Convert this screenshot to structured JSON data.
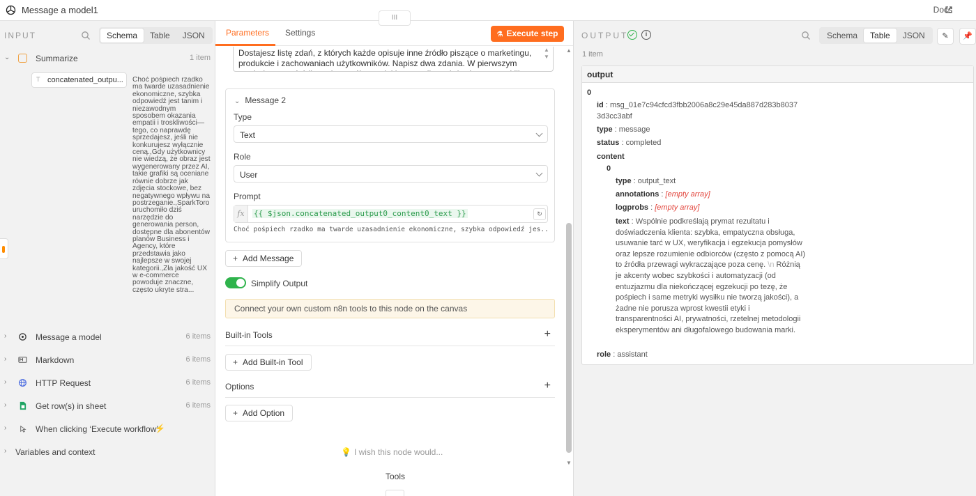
{
  "window": {
    "title": "Message a model1",
    "docs_label": "Docs",
    "drag_handle": "III"
  },
  "input": {
    "heading": "INPUT",
    "views": [
      "Schema",
      "Table",
      "JSON"
    ],
    "active_view": "Schema",
    "summarize": {
      "label": "Summarize",
      "count": "1 item"
    },
    "field": {
      "type_glyph": "T",
      "name": "concatenated_outpu...",
      "value": "Choć pośpiech rzadko ma twarde uzasadnienie ekonomiczne, szybka odpowiedź jest tanim i niezawodnym sposobem okazania empatii i troskliwości—tego, co naprawdę sprzedajesz, jeśli nie konkurujesz wyłącznie ceną.,Gdy użytkownicy nie wiedzą, że obraz jest wygenerowany przez AI, takie grafiki są oceniane równie dobrze jak zdjęcia stockowe, bez negatywnego wpływu na postrzeganie.,SparkToro uruchomiło dziś narzędzie do generowania person, dostępne dla abonentów planów Business i Agency, które przedstawia jako najlepsze w swojej kategorii.,Zła jakość UX w e-commerce powoduje znaczne, często ukryte stra..."
    },
    "nodes": [
      {
        "label": "Message a model",
        "count": "6 items",
        "icon": "openai-icon"
      },
      {
        "label": "Markdown",
        "count": "6 items",
        "icon": "markdown-icon"
      },
      {
        "label": "HTTP Request",
        "count": "6 items",
        "icon": "globe-icon"
      },
      {
        "label": "Get row(s) in sheet",
        "count": "6 items",
        "icon": "sheets-icon"
      },
      {
        "label": "When clicking ‘Execute workflow’",
        "count": "",
        "icon": "cursor-icon"
      }
    ],
    "variables_label": "Variables and context"
  },
  "params": {
    "tabs": [
      "Parameters",
      "Settings"
    ],
    "active_tab": "Parameters",
    "execute_label": "Execute step",
    "message1_text": "Dostajesz listę zdań, z których każde opisuje inne źródło piszące o marketingu, produkcie i zachowaniach użytkowników. Napisz dwa zdania. W pierwszym powiedz, co te źródła mają wspólnego, jaki temat albo założenie wraca u kilku",
    "message2": {
      "heading": "Message 2",
      "type_label": "Type",
      "type_value": "Text",
      "role_label": "Role",
      "role_value": "User",
      "prompt_label": "Prompt",
      "fx": "fx",
      "expression": "{{ $json.concatenated_output0_content0_text }}",
      "preview": "Choć pośpiech rzadko ma twarde uzasadnienie ekonomiczne, szybka odpowiedź jes..."
    },
    "add_message_label": "Add Message",
    "simplify_label": "Simplify Output",
    "simplify_on": true,
    "notice": "Connect your own custom n8n tools to this node on the canvas",
    "builtin_tools_label": "Built-in Tools",
    "add_builtin_label": "Add Built-in Tool",
    "options_label": "Options",
    "add_option_label": "Add Option",
    "wish_label": "I wish this node would...",
    "tools_label": "Tools"
  },
  "output": {
    "heading": "OUTPUT",
    "views": [
      "Schema",
      "Table",
      "JSON"
    ],
    "active_view": "Table",
    "item_count": "1 item",
    "column": "output",
    "index0": "0",
    "id_key": "id",
    "id_value": "msg_01e7c94cfcd3fbb2006a8c29e45da887d283b80373d3cc3abf",
    "type_key": "type",
    "type_value": "message",
    "status_key": "status",
    "status_value": "completed",
    "content_key": "content",
    "content_index": "0",
    "ctype_key": "type",
    "ctype_value": "output_text",
    "annotations_key": "annotations",
    "annotations_value": "[empty array]",
    "logprobs_key": "logprobs",
    "logprobs_value": "[empty array]",
    "text_key": "text",
    "text_part1": "Wspólnie podkreślają prymat rezultatu i doświadczenia klienta: szybka, empatyczna obsługa, usuwanie tarć w UX, weryfikacja i egzekucja pomysłów oraz lepsze rozumienie odbiorców (często z pomocą AI) to źródła przewagi wykraczające poza cenę.",
    "text_newline": "\\n",
    "text_part2": "Różnią je akcenty wobec szybkości i automatyzacji (od entuzjazmu dla niekończącej egzekucji po tezę, że pośpiech i same metryki wysiłku nie tworzą jakości), a żadne nie porusza wprost kwestii etyki i transparentności AI, prywatności, rzetelnej metodologii eksperymentów ani długofalowego budowania marki.",
    "role_key": "role",
    "role_value": "assistant"
  },
  "colors": {
    "accent": "#ff6d1f",
    "success": "#2fb34c",
    "empty": "#e2453c"
  }
}
